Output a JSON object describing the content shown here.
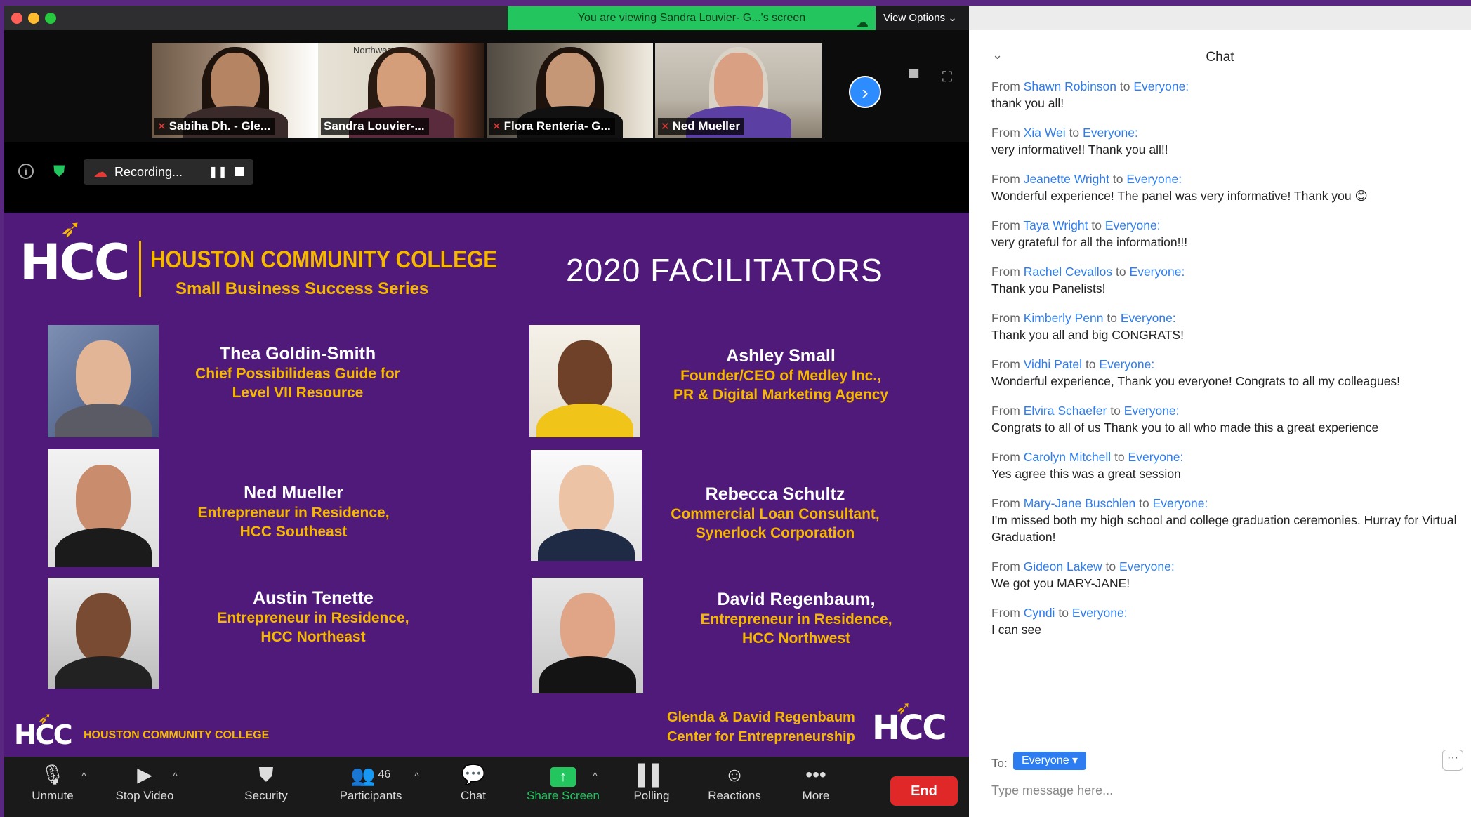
{
  "window": {
    "banner": "You are viewing Sandra Louvier- G...'s screen",
    "view_options": "View Options ⌄",
    "colors": {
      "close": "#ff5f57",
      "minimize": "#febc2e",
      "maximize": "#28c840",
      "banner": "#22c55e",
      "accent": "#2d8cff",
      "end": "#e02828"
    }
  },
  "thumbnails": [
    {
      "name": "Sabiha Dh. - Gle...",
      "muted": true
    },
    {
      "name": "Sandra Louvier-...",
      "muted": false,
      "active": true,
      "watermark": "Northwest"
    },
    {
      "name": "Flora Renteria- G...",
      "muted": true
    },
    {
      "name": "Ned Mueller",
      "muted": true
    }
  ],
  "recording": {
    "label": "Recording..."
  },
  "slide": {
    "logo_text": "HCC",
    "college": "HOUSTON COMMUNITY COLLEGE",
    "series": "Small Business Success Series",
    "heading": "2020 FACILITATORS",
    "facilitators": [
      {
        "name": "Thea Goldin-Smith",
        "role1": "Chief Possibilideas Guide for",
        "role2": "Level VII Resource"
      },
      {
        "name": "Ashley Small",
        "role1": "Founder/CEO of Medley Inc.,",
        "role2": "PR & Digital Marketing Agency"
      },
      {
        "name": "Ned Mueller",
        "role1": "Entrepreneur in Residence,",
        "role2": "HCC Southeast"
      },
      {
        "name": "Rebecca Schultz",
        "role1": "Commercial Loan Consultant,",
        "role2": "Synerlock Corporation"
      },
      {
        "name": "Austin Tenette",
        "role1": "Entrepreneur in Residence,",
        "role2": "HCC Northeast"
      },
      {
        "name": "David Regenbaum,",
        "role1": "Entrepreneur in Residence,",
        "role2": "HCC Northwest"
      }
    ],
    "footer_college": "HOUSTON COMMUNITY COLLEGE",
    "footer_right_1": "Glenda & David Regenbaum",
    "footer_right_2": "Center for Entrepreneurship"
  },
  "controls": {
    "unmute": "Unmute",
    "stop_video": "Stop Video",
    "security": "Security",
    "participants": "Participants",
    "participants_count": "46",
    "chat": "Chat",
    "share_screen": "Share Screen",
    "polling": "Polling",
    "reactions": "Reactions",
    "more": "More",
    "end": "End"
  },
  "chat": {
    "title": "Chat",
    "from_word": "From",
    "to_word": "to",
    "messages": [
      {
        "from": "Shawn Robinson",
        "to": "Everyone:",
        "text": "thank you all!"
      },
      {
        "from": "Xia Wei",
        "to": "Everyone:",
        "text": "very informative!! Thank you all!!"
      },
      {
        "from": "Jeanette Wright",
        "to": "Everyone:",
        "text": "Wonderful experience! The panel was very informative! Thank you 😊"
      },
      {
        "from": "Taya Wright",
        "to": "Everyone:",
        "text": "very grateful for all the information!!!"
      },
      {
        "from": "Rachel Cevallos",
        "to": "Everyone:",
        "text": "Thank you Panelists!"
      },
      {
        "from": "Kimberly Penn",
        "to": "Everyone:",
        "text": "Thank you all and big CONGRATS!"
      },
      {
        "from": "Vidhi Patel",
        "to": "Everyone:",
        "text": "Wonderful experience, Thank you everyone! Congrats to all my colleagues!"
      },
      {
        "from": "Elvira Schaefer",
        "to": "Everyone:",
        "text": "Congrats to all of us Thank you to all who made this a great experience"
      },
      {
        "from": "Carolyn Mitchell",
        "to": "Everyone:",
        "text": "Yes agree this was a great session"
      },
      {
        "from": "Mary-Jane Buschlen",
        "to": "Everyone:",
        "text": "I'm missed both my high school and college graduation ceremonies. Hurray for Virtual Graduation!"
      },
      {
        "from": "Gideon Lakew",
        "to": "Everyone:",
        "text": "We got you MARY-JANE!"
      },
      {
        "from": "Cyndi",
        "to": "Everyone:",
        "text": "I can see"
      }
    ],
    "to_label": "To:",
    "to_value": "Everyone ▾",
    "placeholder": "Type message here..."
  }
}
